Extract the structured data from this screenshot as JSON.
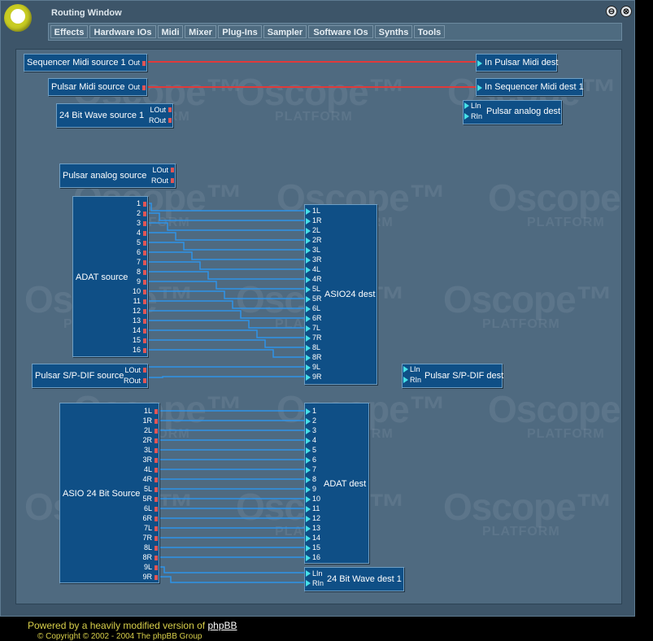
{
  "window": {
    "title": "Routing Window",
    "minimize_label": "⊖",
    "close_label": "⊗"
  },
  "menu": {
    "items": [
      {
        "label": "Effects"
      },
      {
        "label": "Hardware IOs"
      },
      {
        "label": "Midi"
      },
      {
        "label": "Mixer"
      },
      {
        "label": "Plug-Ins"
      },
      {
        "label": "Sampler"
      },
      {
        "label": "Software IOs"
      },
      {
        "label": "Synths"
      },
      {
        "label": "Tools"
      }
    ]
  },
  "watermark": {
    "big": "Oscope™",
    "small": "PLATFORM"
  },
  "modules": {
    "seq_midi_src": {
      "name": "Sequencer Midi source 1",
      "out": "Out"
    },
    "pulsar_midi_dest": {
      "name": "In Pulsar Midi dest"
    },
    "pulsar_midi_src": {
      "name": "Pulsar Midi source",
      "out": "Out"
    },
    "seq_midi_dest": {
      "name": "In Sequencer Midi dest 1"
    },
    "wave_src": {
      "name": "24 Bit Wave source 1",
      "lout": "LOut",
      "rout": "ROut"
    },
    "pulsar_analog_dest": {
      "name": "Pulsar analog dest",
      "lin": "LIn",
      "rin": "RIn"
    },
    "pulsar_analog_src": {
      "name": "Pulsar analog source",
      "lout": "LOut",
      "rout": "ROut"
    },
    "adat_src": {
      "name": "ADAT source",
      "ports": [
        "1",
        "2",
        "3",
        "4",
        "5",
        "6",
        "7",
        "8",
        "9",
        "10",
        "11",
        "12",
        "13",
        "14",
        "15",
        "16"
      ]
    },
    "asio24_dest": {
      "name": "ASIO24 dest",
      "ports": [
        "1L",
        "1R",
        "2L",
        "2R",
        "3L",
        "3R",
        "4L",
        "4R",
        "5L",
        "5R",
        "6L",
        "6R",
        "7L",
        "7R",
        "8L",
        "8R",
        "9L",
        "9R"
      ]
    },
    "spdif_src": {
      "name": "Pulsar S/P-DIF source",
      "lout": "LOut",
      "rout": "ROut"
    },
    "spdif_dest": {
      "name": "Pulsar S/P-DIF dest",
      "lin": "LIn",
      "rin": "RIn"
    },
    "asio_src": {
      "name": "ASIO 24 Bit Source",
      "ports": [
        "1L",
        "1R",
        "2L",
        "2R",
        "3L",
        "3R",
        "4L",
        "4R",
        "5L",
        "5R",
        "6L",
        "6R",
        "7L",
        "7R",
        "8L",
        "8R",
        "9L",
        "9R"
      ]
    },
    "adat_dest": {
      "name": "ADAT dest",
      "ports": [
        "1",
        "2",
        "3",
        "4",
        "5",
        "6",
        "7",
        "8",
        "9",
        "10",
        "11",
        "12",
        "13",
        "14",
        "15",
        "16"
      ]
    },
    "wave_dest": {
      "name": "24 Bit Wave dest 1",
      "lin": "LIn",
      "rin": "RIn"
    }
  },
  "colors": {
    "midi_wire": "#e03a3a",
    "audio_wire": "#2f93e8",
    "port_in": "#46e0e8",
    "port_out": "#e05555",
    "footer_text": "#d8cf4a"
  },
  "footer": {
    "prefix": "Powered by a heavily modified version of",
    "link": "phpBB",
    "copyright": "© Copyright © 2002 - 2004 The phpBB Group"
  }
}
